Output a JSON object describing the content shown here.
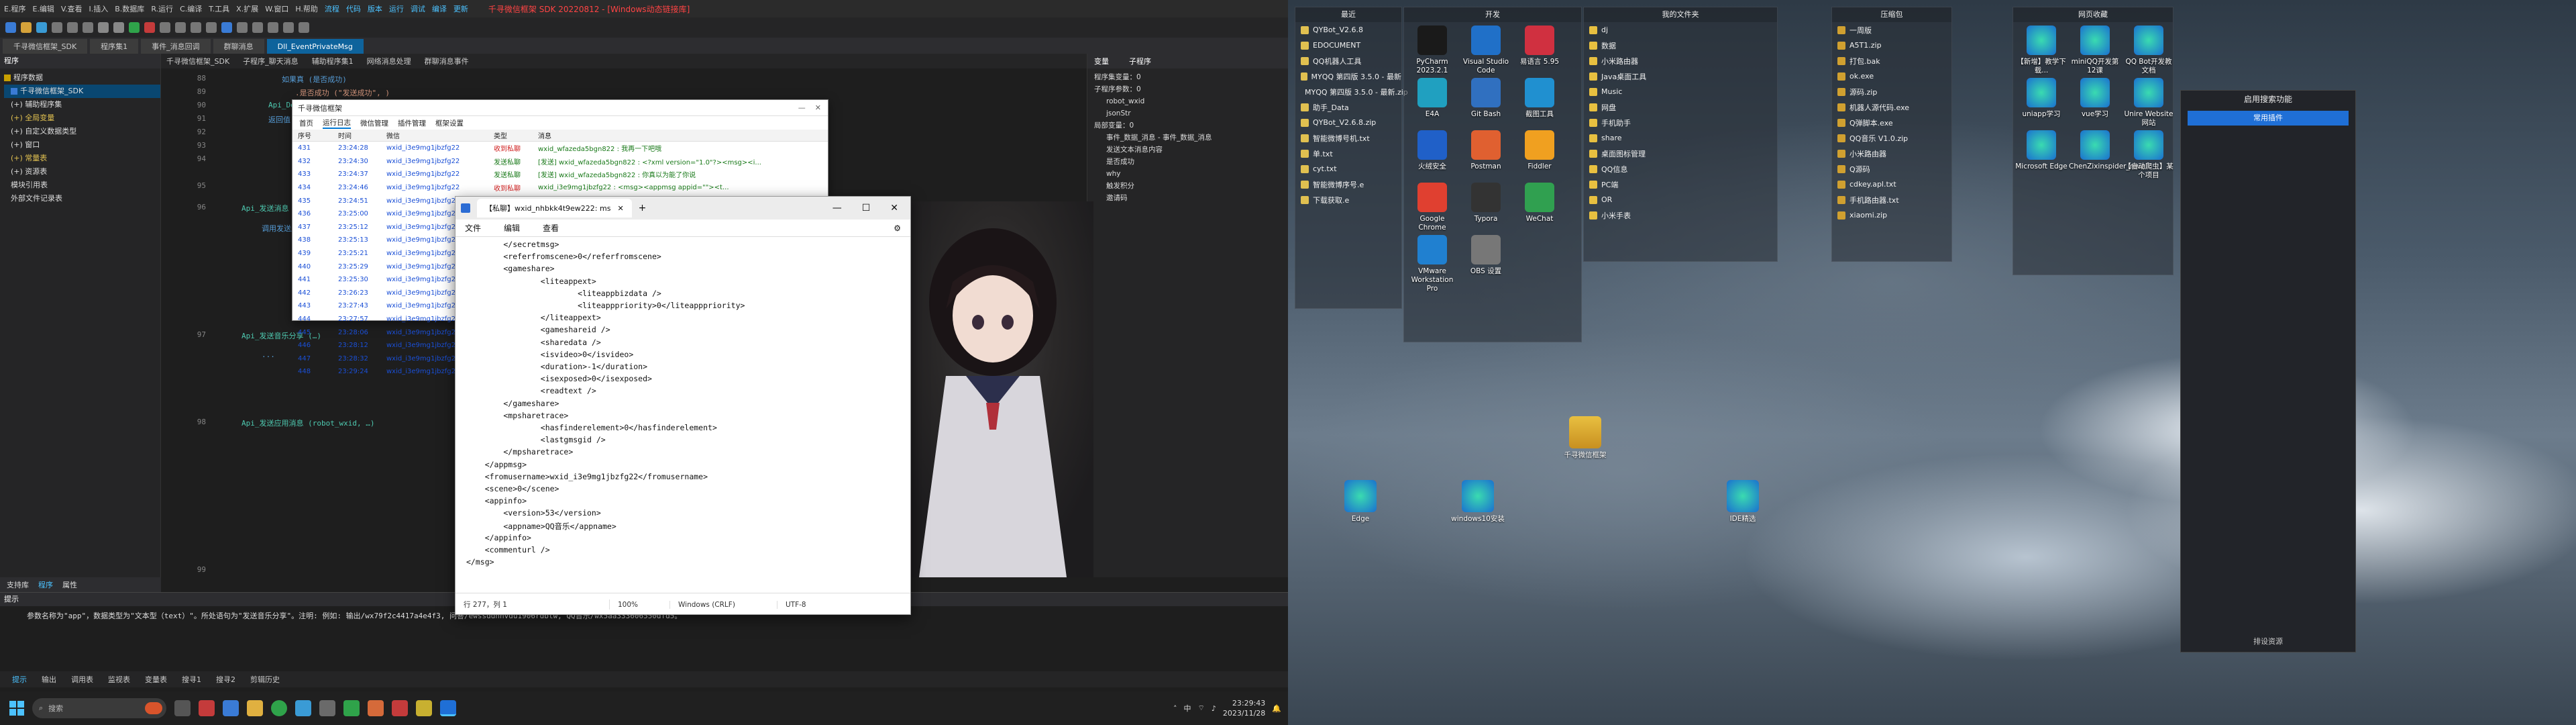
{
  "ide": {
    "title": "千寻微信框架 SDK 20220812 - [Windows动态链接库]",
    "menu": [
      "E.程序",
      "E.编辑",
      "V.查看",
      "I.插入",
      "B.数据库",
      "R.运行",
      "C.编译",
      "T.工具",
      "X.扩展",
      "W.窗口",
      "H.帮助",
      "流程",
      "代码",
      "版本",
      "运行",
      "调试",
      "编译",
      "更新"
    ],
    "tabs": [
      "千寻微信框架_SDK",
      "程序集1",
      "事件_消息回调",
      "群聊消息",
      "Dll_EventPrivateMsg"
    ],
    "active_tab": 4,
    "left_panel": {
      "header": "程序",
      "items": [
        "程序数据",
        "千寻微信框架_SDK",
        "(+) 辅助程序集",
        "(+) 全局变量",
        "(+) 自定义数据类型",
        "(+) 窗口",
        "(+) 常量表",
        "(+) 资源表",
        "模块引用表",
        "外部文件记录表"
      ],
      "bottom_tabs": [
        "支持库",
        "程序",
        "属性"
      ]
    },
    "editor_sub": [
      "千寻微信框架_SDK",
      "子程序_聊天消息",
      "辅助程序集1",
      "网络消息处理",
      "群聊消息事件"
    ],
    "line_numbers": [
      "88",
      "89",
      "90",
      "91",
      "92",
      "93",
      "94",
      "95",
      "96",
      "97",
      "98",
      "99",
      "100"
    ],
    "code_lines": [
      "如果真 (是否成功)",
      ".是否成功 (\"发送成功\", )",
      "Api_DecodeStr (...)",
      "返回值",
      "Api_发送消息 (…)",
      "调用发送服务",
      "Api_发送音乐分享 (…)",
      "...",
      "Api_发送应用消息 (robot_wxid, …)"
    ],
    "right_panel": {
      "tabs": [
        "变量",
        "子程序"
      ],
      "items": [
        "程序集变量：0",
        "子程序参数：0",
        "robot_wxid",
        "jsonStr",
        "局部变量：0",
        "事件_数据_消息 - 事件_数据_消息",
        "发送文本消息内容",
        "是否成功",
        "why",
        "触发积分",
        "邀请码"
      ]
    },
    "output": {
      "header": "提示",
      "text": "参数名称为\"app\"，数据类型为\"文本型（text）\"。所处语句为\"发送音乐分享\"。注明: 例如: 输出/wx79f2c4417a4e4f3, 问答/ewssddhnvdu1906rdbtw, QQ音乐/wx5aa333606550dfd5。",
      "tabs": [
        "提示",
        "输出",
        "调用表",
        "监视表",
        "变量表",
        "搜寻1",
        "搜寻2",
        "剪辑历史"
      ]
    },
    "taskbar": {
      "search_placeholder": "搜索",
      "time": "23:29:43",
      "date": "2023/11/28",
      "ime": "中"
    }
  },
  "tool_window": {
    "title": "千寻微信框架",
    "menu": [
      "首页",
      "运行日志",
      "微信管理",
      "插件管理",
      "框架设置"
    ],
    "columns": [
      "序号",
      "时间",
      "微信",
      "类型",
      "消息"
    ],
    "rows": [
      [
        "431",
        "23:24:28",
        "wxid_i3e9mg1jbzfg22",
        "收到私聊",
        "wxid_wfazeda5bgn822 : 我再一下吧哦"
      ],
      [
        "432",
        "23:24:30",
        "wxid_i3e9mg1jbzfg22",
        "发送私聊",
        "[发送] wxid_wfazeda5bgn822 : <?xml version=\"1.0\"?><msg><i..."
      ],
      [
        "433",
        "23:24:37",
        "wxid_i3e9mg1jbzfg22",
        "发送私聊",
        "[发送] wxid_wfazeda5bgn822 : 你真以为能了你说"
      ],
      [
        "434",
        "23:24:46",
        "wxid_i3e9mg1jbzfg22",
        "收到私聊",
        "wxid_i3e9mg1jbzfg22 : <msg><appmsg appid=\"\"><t..."
      ],
      [
        "435",
        "23:24:51",
        "wxid_i3e9mg1jbzfg22",
        "发送私聊",
        "wxid_..."
      ],
      [
        "436",
        "23:25:00",
        "wxid_i3e9mg1jbzfg22",
        "发送私聊",
        ""
      ],
      [
        "437",
        "23:25:12",
        "wxid_i3e9mg1jbzfg22",
        "发送私聊",
        ""
      ],
      [
        "438",
        "23:25:13",
        "wxid_i3e9mg1jbzfg22",
        "发送私聊",
        ""
      ],
      [
        "439",
        "23:25:21",
        "wxid_i3e9mg1jbzfg22",
        "收到私聊",
        ""
      ],
      [
        "440",
        "23:25:29",
        "wxid_i3e9mg1jbzfg22",
        "发送私聊",
        ""
      ],
      [
        "441",
        "23:25:30",
        "wxid_i3e9mg1jbzfg22",
        "发送私聊",
        ""
      ],
      [
        "442",
        "23:26:23",
        "wxid_i3e9mg1jbzfg22",
        "收到私聊",
        ""
      ],
      [
        "443",
        "23:27:43",
        "wxid_i3e9mg1jbzfg22",
        "发送私聊",
        ""
      ],
      [
        "444",
        "23:27:57",
        "wxid_i3e9mg1jbzfg22",
        "发送私聊",
        ""
      ],
      [
        "445",
        "23:28:06",
        "wxid_i3e9mg1jbzfg22",
        "收到私聊",
        ""
      ],
      [
        "446",
        "23:28:12",
        "wxid_i3e9mg1jbzfg22",
        "发送私聊",
        ""
      ],
      [
        "447",
        "23:28:32",
        "wxid_i3e9mg1jbzfg22",
        "发送私聊",
        ""
      ],
      [
        "448",
        "23:29:24",
        "wxid_i3e9mg1jbzfg22",
        "收到私聊",
        ""
      ]
    ]
  },
  "notepad": {
    "tab_title": "【私聊】wxid_nhbkk4t9ew222: ms",
    "menu": [
      "文件",
      "编辑",
      "查看"
    ],
    "lines": [
      "        </secretmsg>",
      "        <referfromscene>0</referfromscene>",
      "        <gameshare>",
      "                <liteappext>",
      "                        <liteappbizdata />",
      "                        <liteapppriority>0</liteapppriority>",
      "                </liteappext>",
      "                <gameshareid />",
      "                <sharedata />",
      "                <isvideo>0</isvideo>",
      "                <duration>-1</duration>",
      "                <isexposed>0</isexposed>",
      "                <readtext />",
      "        </gameshare>",
      "        <mpsharetrace>",
      "                <hasfinderelement>0</hasfinderelement>",
      "                <lastgmsgid />",
      "        </mpsharetrace>",
      "    </appmsg>",
      "    <fromusername>wxid_i3e9mg1jbzfg22</fromusername>",
      "    <scene>0</scene>",
      "    <appinfo>",
      "        <version>53</version>",
      "        <appname>QQ音乐</appname>",
      "    </appinfo>",
      "    <commenturl />",
      "</msg>"
    ],
    "status": [
      "行 277，列 1",
      "100%",
      "Windows (CRLF)",
      "UTF-8"
    ]
  },
  "desktop": {
    "fences": [
      {
        "title": "最近",
        "items": [
          "QYBot_V2.6.8",
          "EDOCUMENT",
          "QQ机器人工具",
          "MYQQ 第四版 3.5.0 - 最新",
          "MYQQ 第四版 3.5.0 - 最新.zip",
          "助手_Data",
          "QYBot_V2.6.8.zip",
          "智能微博号机.txt",
          "单.txt",
          "cyt.txt",
          "智能微博序号.e",
          "下载获取.e"
        ]
      },
      {
        "title": "开发",
        "items": []
      },
      {
        "title": "我的文件夹",
        "items": [
          "dj",
          "数据",
          "小米路由器",
          "Java桌面工具",
          "Music",
          "网盘",
          "手机助手",
          "share",
          "桌面图标管理",
          "QQ信息",
          "PC端",
          "OR",
          "小米手表"
        ]
      },
      {
        "title": "压缩包",
        "items": [
          "一周版",
          "A5T1.zip",
          "打包.bak",
          "ok.exe",
          "源码.zip",
          "机器人源代码.exe",
          "Q弹脚本.exe",
          "QQ音乐 V1.0.zip",
          "小米路由器",
          "Q源码",
          "cdkey.apl.txt",
          "手机路由器.txt",
          "xiaomi.zip"
        ]
      },
      {
        "title": "网页收藏",
        "items": []
      }
    ],
    "dev_icons": [
      "PyCharm 2023.2.1",
      "Visual Studio Code",
      "易语言 5.95",
      "E4A",
      "Git Bash",
      "截图工具",
      "火绒安全",
      "Postman",
      "Fiddler",
      "Google Chrome",
      "Typora",
      "WeChat",
      "VMware Workstation Pro",
      "OBS 设置"
    ],
    "web_icons": [
      "【新增】教学下载...",
      "miniQQ开发第12课",
      "QQ Bot开发教文档",
      "uniapp学习",
      "vue学习",
      "Unire Website 网站",
      "Microsoft Edge",
      "ChenZixinspider_reve...",
      "【自动爬虫】某个项目"
    ],
    "loose_icons": [
      "千寻微信框架",
      "Edge",
      "windows10安装",
      "IDE精选"
    ],
    "menu_panel": {
      "title": "启用搜索功能",
      "button": "常用插件",
      "footer": "排设资源"
    }
  }
}
